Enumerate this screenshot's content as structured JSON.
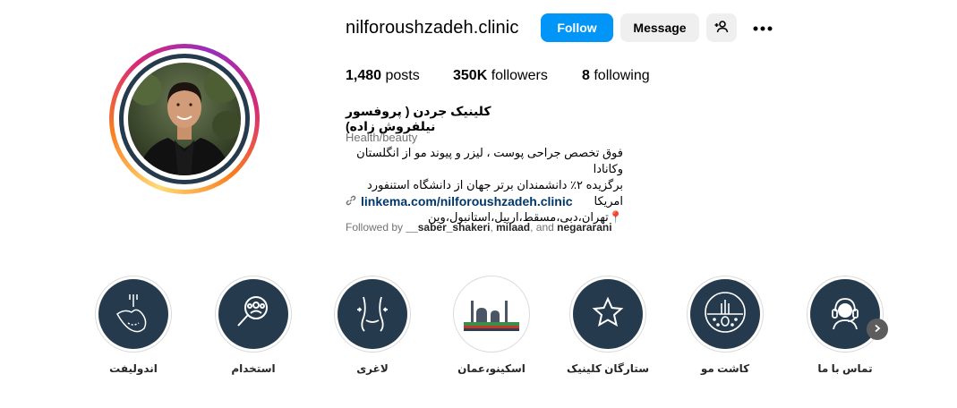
{
  "profile": {
    "username": "nilforoushzadeh.clinic",
    "follow_label": "Follow",
    "message_label": "Message",
    "posts_count": "1,480",
    "posts_label": "posts",
    "followers_count": "350K",
    "followers_label": "followers",
    "following_count": "8",
    "following_label": "following",
    "full_name": "کلینیک جردن ( پروفسور نیلفروش زاده)",
    "category": "Health/beauty",
    "bio_lines": [
      "فوق تخصص جراحی پوست ، لیزر و پیوند مو از انگلستان وکانادا",
      "برگزیده ۲٪ دانشمندان برتر جهان از دانشگاه استنفورد امریکا",
      "📍تهران،دبی،مسقط،اربیل،استانبول،وین"
    ],
    "link": "linkema.com/nilforoushzadeh.clinic",
    "followed_by_prefix": "Followed by ",
    "followed_by_users": [
      "__saber_shakeri",
      "milaad",
      "negararani"
    ],
    "followed_by_sep": ", ",
    "followed_by_and": ", and "
  },
  "highlights": [
    {
      "label": "اندولیفت",
      "icon": "face-lift-icon"
    },
    {
      "label": "استخدام",
      "icon": "search-people-icon"
    },
    {
      "label": "لاغری",
      "icon": "body-slim-icon"
    },
    {
      "label": "اسکینو،عمان",
      "icon": "mosque-skyline-icon"
    },
    {
      "label": "ستارگان کلینیک",
      "icon": "star-icon"
    },
    {
      "label": "کاشت مو",
      "icon": "hair-follicle-icon"
    },
    {
      "label": "تماس با ما",
      "icon": "support-agent-icon"
    }
  ],
  "colors": {
    "primary_button": "#0095f6",
    "secondary_button": "#efefef",
    "highlight_bg": "#253a4d",
    "link": "#00376b",
    "muted": "#737373"
  }
}
